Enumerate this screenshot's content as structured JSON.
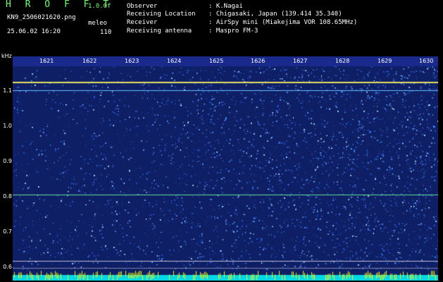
{
  "header": {
    "brand": "H R O F F T",
    "version": "1.0.0f",
    "filename": "KN9_2506021620.png",
    "datetime": "25.06.02 16:20",
    "meleo_label": "meleo",
    "meleo_value": "110"
  },
  "info": [
    {
      "key": "Observer",
      "value": ": K.Nagai"
    },
    {
      "key": "Receiving Location",
      "value": ": Chigasaki, Japan (139.414 35.340)"
    },
    {
      "key": "Receiver",
      "value": ": AirSpy mini (Miakejima VOR 108.65MHz)"
    },
    {
      "key": "Receiving antenna",
      "value": ": Maspro FM-3"
    }
  ],
  "axes": {
    "y_unit": "kHz",
    "y_ticks": [
      "1.1",
      "1.0",
      "0.9",
      "0.8",
      "0.7",
      "0.6"
    ],
    "x_ticks": [
      "1621",
      "1622",
      "1623",
      "1624",
      "1625",
      "1626",
      "1627",
      "1628",
      "1629",
      "1630"
    ]
  },
  "colors": {
    "background": "#000000",
    "waterfall_base": "#102a78",
    "brand_green": "#6cff6c",
    "bottom_cyan": "#00d8e8",
    "bottom_yellow": "#f0f000"
  }
}
